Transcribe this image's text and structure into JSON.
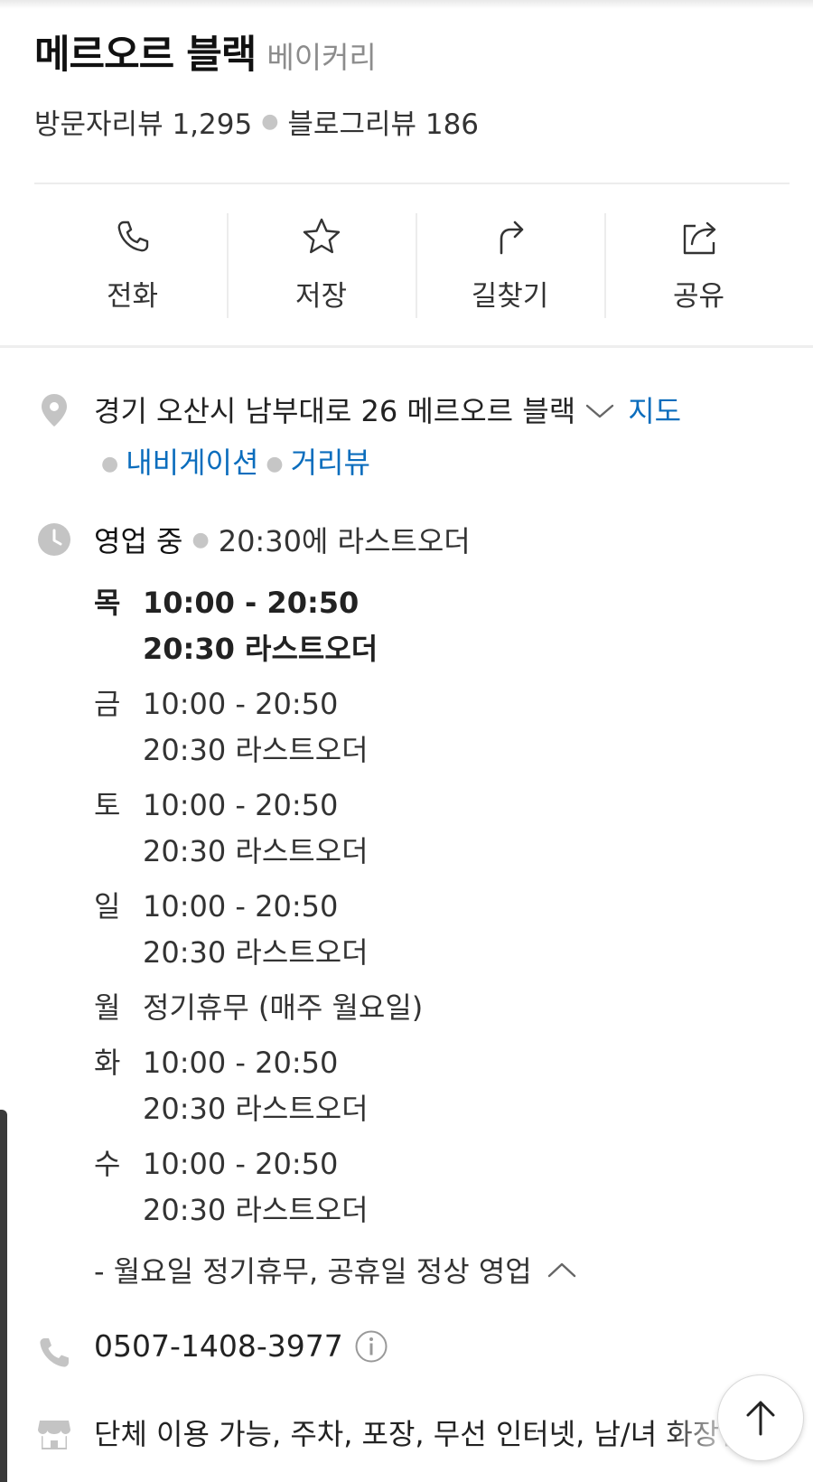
{
  "place": {
    "name": "메르오르 블랙",
    "category": "베이커리"
  },
  "reviews": {
    "visitor": "방문자리뷰 1,295",
    "blog": "블로그리뷰 186"
  },
  "actions": [
    {
      "label": "전화",
      "icon": "phone-icon"
    },
    {
      "label": "저장",
      "icon": "star-icon"
    },
    {
      "label": "길찾기",
      "icon": "directions-icon"
    },
    {
      "label": "공유",
      "icon": "share-icon"
    }
  ],
  "address": {
    "text": "경기 오산시 남부대로 26 메르오르 블랙",
    "map_link": "지도",
    "navigation_link": "내비게이션",
    "streetview_link": "거리뷰"
  },
  "business": {
    "status": "영업 중",
    "last_order": "20:30에 라스트오더",
    "hours": [
      {
        "day": "목",
        "time": "10:00 - 20:50",
        "last": "20:30 라스트오더",
        "today": true
      },
      {
        "day": "금",
        "time": "10:00 - 20:50",
        "last": "20:30 라스트오더",
        "today": false
      },
      {
        "day": "토",
        "time": "10:00 - 20:50",
        "last": "20:30 라스트오더",
        "today": false
      },
      {
        "day": "일",
        "time": "10:00 - 20:50",
        "last": "20:30 라스트오더",
        "today": false
      },
      {
        "day": "월",
        "time": "정기휴무 (매주 월요일)",
        "last": "",
        "today": false
      },
      {
        "day": "화",
        "time": "10:00 - 20:50",
        "last": "20:30 라스트오더",
        "today": false
      },
      {
        "day": "수",
        "time": "10:00 - 20:50",
        "last": "20:30 라스트오더",
        "today": false
      }
    ],
    "note": "- 월요일 정기휴무, 공휴일 정상 영업"
  },
  "phone": "0507-1408-3977",
  "amenities": "단체 이용 가능, 주차, 포장, 무선 인터넷, 남/녀 화장실",
  "colors": {
    "link": "#0b6dbd",
    "icon_gray": "#c4c4c4",
    "text": "#222222"
  }
}
